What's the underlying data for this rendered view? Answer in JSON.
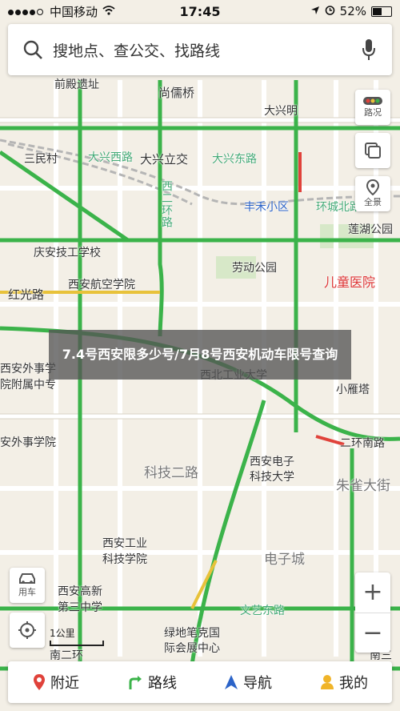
{
  "status_bar": {
    "carrier": "中国移动",
    "time": "17:45",
    "battery": "52%"
  },
  "search": {
    "placeholder": "搜地点、查公交、找路线"
  },
  "controls": {
    "traffic": "路况",
    "panorama": "全景",
    "car": "用车"
  },
  "zoom": {
    "in": "+",
    "out": "−"
  },
  "scale": {
    "label": "1公里"
  },
  "banner": {
    "text": "7.4号西安限多少号/7月8号西安机动车限号查询"
  },
  "bottom_nav": {
    "nearby": "附近",
    "route": "路线",
    "navigation": "导航",
    "mine": "我的"
  },
  "map_labels": {
    "qiandian": "前殿遗址",
    "shangru": "尚儒桥",
    "daxingming": "大兴明",
    "sanmincun": "三民村",
    "daxingxilu": "大兴西路",
    "daxinglijiao": "大兴立交",
    "daxingdonglu": "大兴东路",
    "xierhuan": "西二环路",
    "xianfeng": "丰禾小区",
    "huanchengbei": "环城北路",
    "lianhu": "莲湖公园",
    "qingan": "庆安技工学校",
    "laodong": "劳动公园",
    "hongguang": "红光路",
    "hangkong": "西安航空学院",
    "ertong": "儿童医院",
    "waishi": "西安外事学",
    "waishi2": "院附属中专",
    "xibei": "西北工业大学",
    "xiaoyanta": "小雁塔",
    "waishixueyuan": "安外事学院",
    "dianzi": "西安电子",
    "dianzi2": "科技大学",
    "zhuque": "朱雀大街",
    "keji2": "科技二路",
    "gongye": "西安工业",
    "gongye2": "科技学院",
    "dianzicheng": "电子城",
    "gaoxin": "西安高新",
    "gaoxin2": "第三中学",
    "lvdi": "绿地笔克国",
    "lvdi2": "际会展中心",
    "nanerhuan": "南二环",
    "wenyi": "文艺东路",
    "erhuan": "二环南路",
    "nansan": "南三"
  }
}
